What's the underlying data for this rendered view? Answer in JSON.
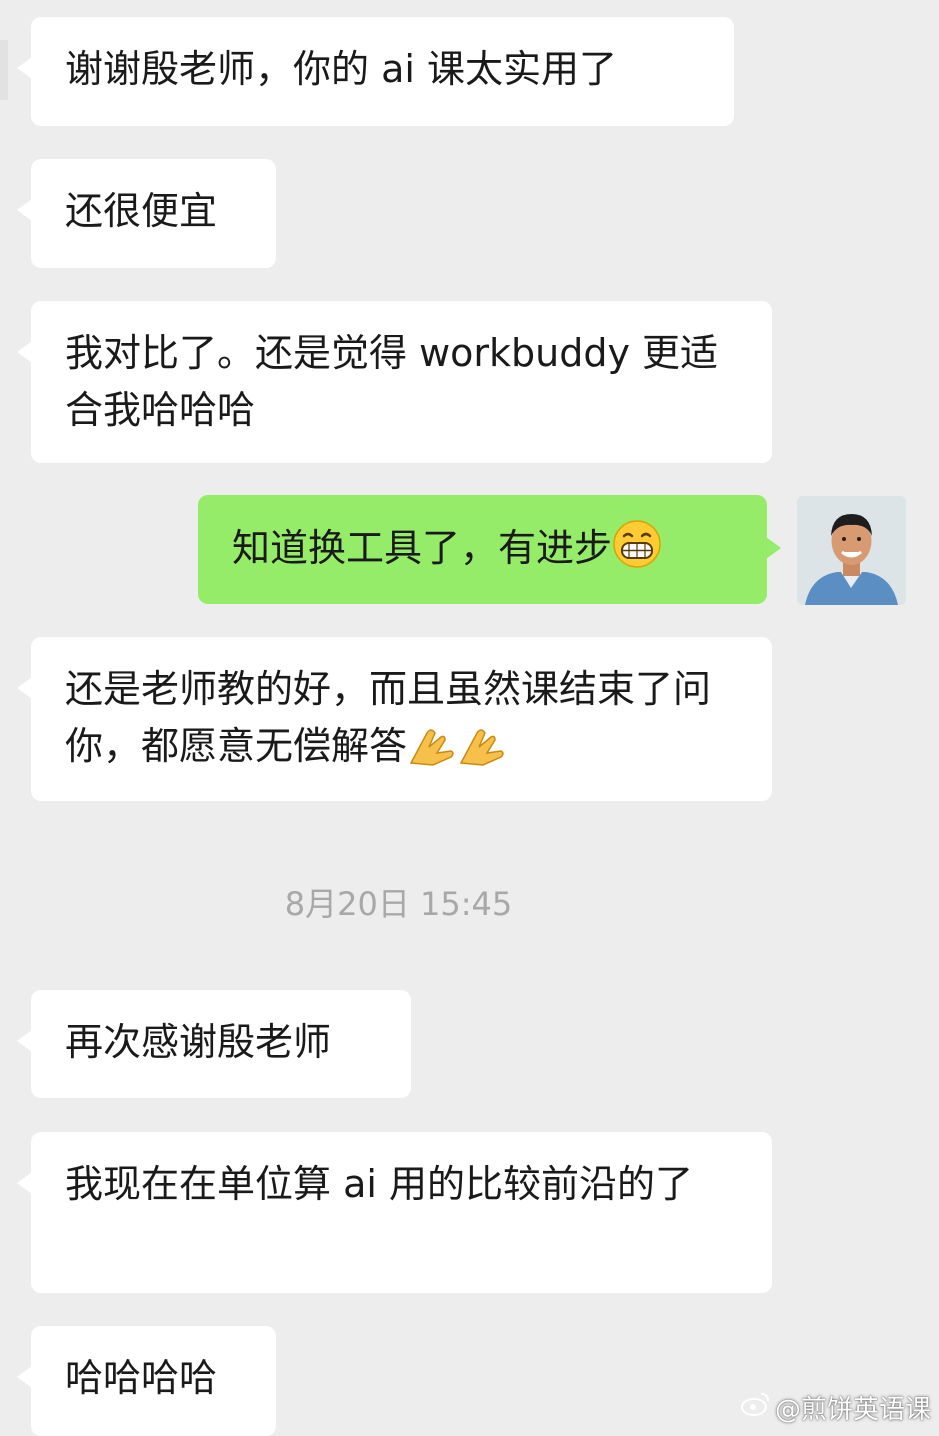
{
  "messages": [
    {
      "side": "left",
      "text": "谢谢殷老师，你的 ai 课太实用了"
    },
    {
      "side": "left",
      "text": "还很便宜"
    },
    {
      "side": "left",
      "text": "我对比了。还是觉得 workbuddy 更适合我哈哈哈"
    },
    {
      "side": "right",
      "text": "知道换工具了，有进步",
      "emoji": "grinning-face-icon"
    },
    {
      "side": "left",
      "text": "还是老师教的好，而且虽然课结束了问你，都愿意无偿解答",
      "emoji": "folded-hands-icon x2"
    },
    {
      "side": "left",
      "text": "再次感谢殷老师"
    },
    {
      "side": "left",
      "text": "我现在在单位算 ai 用的比较前沿的了"
    },
    {
      "side": "left",
      "text": "哈哈哈哈"
    }
  ],
  "timestamp": "8月20日 15:45",
  "watermark": "@煎饼英语课",
  "colors": {
    "background": "#ededed",
    "incoming": "#ffffff",
    "outgoing": "#95ec69",
    "timestamp": "#a8a8a8"
  }
}
